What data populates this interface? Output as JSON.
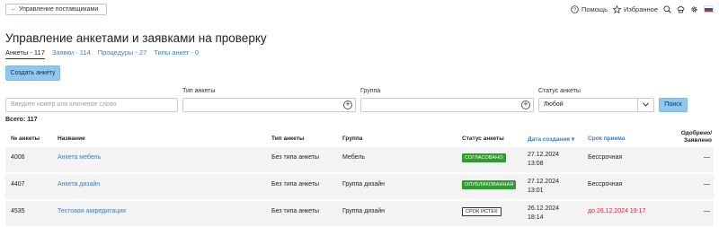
{
  "topbar": {
    "back_label": "← Управление поставщиками",
    "help_label": "Помощь",
    "favorites_label": "Избранное",
    "icons": [
      "help-icon",
      "star-icon",
      "search-icon",
      "chef-hat-icon",
      "settings-icon",
      "flag-ru-icon"
    ]
  },
  "page": {
    "title": "Управление анкетами и заявками на проверку"
  },
  "tabs": [
    {
      "label": "Анкеты - 117",
      "active": true
    },
    {
      "label": "Заявки - 114",
      "active": false
    },
    {
      "label": "Процедуры - 27",
      "active": false
    },
    {
      "label": "Типы анкет - 0",
      "active": false
    }
  ],
  "create_button_label": "Создать анкету",
  "filters": {
    "search_placeholder": "Введите номер или ключевое слово",
    "type_label": "Тип анкеты",
    "type_value": "",
    "group_label": "Группа",
    "group_value": "",
    "status_label": "Статус анкеты",
    "status_value": "Любой",
    "search_button_label": "Поиск"
  },
  "total_label": "Всего: 117",
  "table": {
    "headers": {
      "number": "№ анкеты",
      "name": "Название",
      "type": "Тип анкеты",
      "group": "Группа",
      "status": "Статус анкеты",
      "created": "Дата создания ▾",
      "term": "Срок приема",
      "approved_1": "Одобрено/",
      "approved_2": "Заявлено"
    },
    "rows": [
      {
        "number": "4006",
        "name": "Анкета мебель",
        "type": "Без типа анкеты",
        "group": "Мебель",
        "status": "СОГЛАСОВАНО",
        "date": "27.12.2024",
        "time": "13:08",
        "term": "Бессрочная",
        "approved": "—"
      },
      {
        "number": "4407",
        "name": "Анкета дизайн",
        "type": "Без типа анкеты",
        "group": "Группа дизайн",
        "status": "ОПУБЛИКОВАННАЯ",
        "date": "27.12.2024",
        "time": "13:01",
        "term": "Бессрочная",
        "approved": "—"
      },
      {
        "number": "4535",
        "name": "Тестовая аккредитация",
        "type": "Без типа анкеты",
        "group": "Группа дизайн",
        "status": "СРОК ИСТЕК",
        "date": "26.12.2024",
        "time": "18:14",
        "term": "до 26.12.2024 19:17",
        "approved": "—"
      }
    ]
  },
  "colors": {
    "link": "#3a7bd5",
    "button": "#8ec8f2",
    "status_green": "#2f9e2f",
    "expired": "#d9263b"
  }
}
